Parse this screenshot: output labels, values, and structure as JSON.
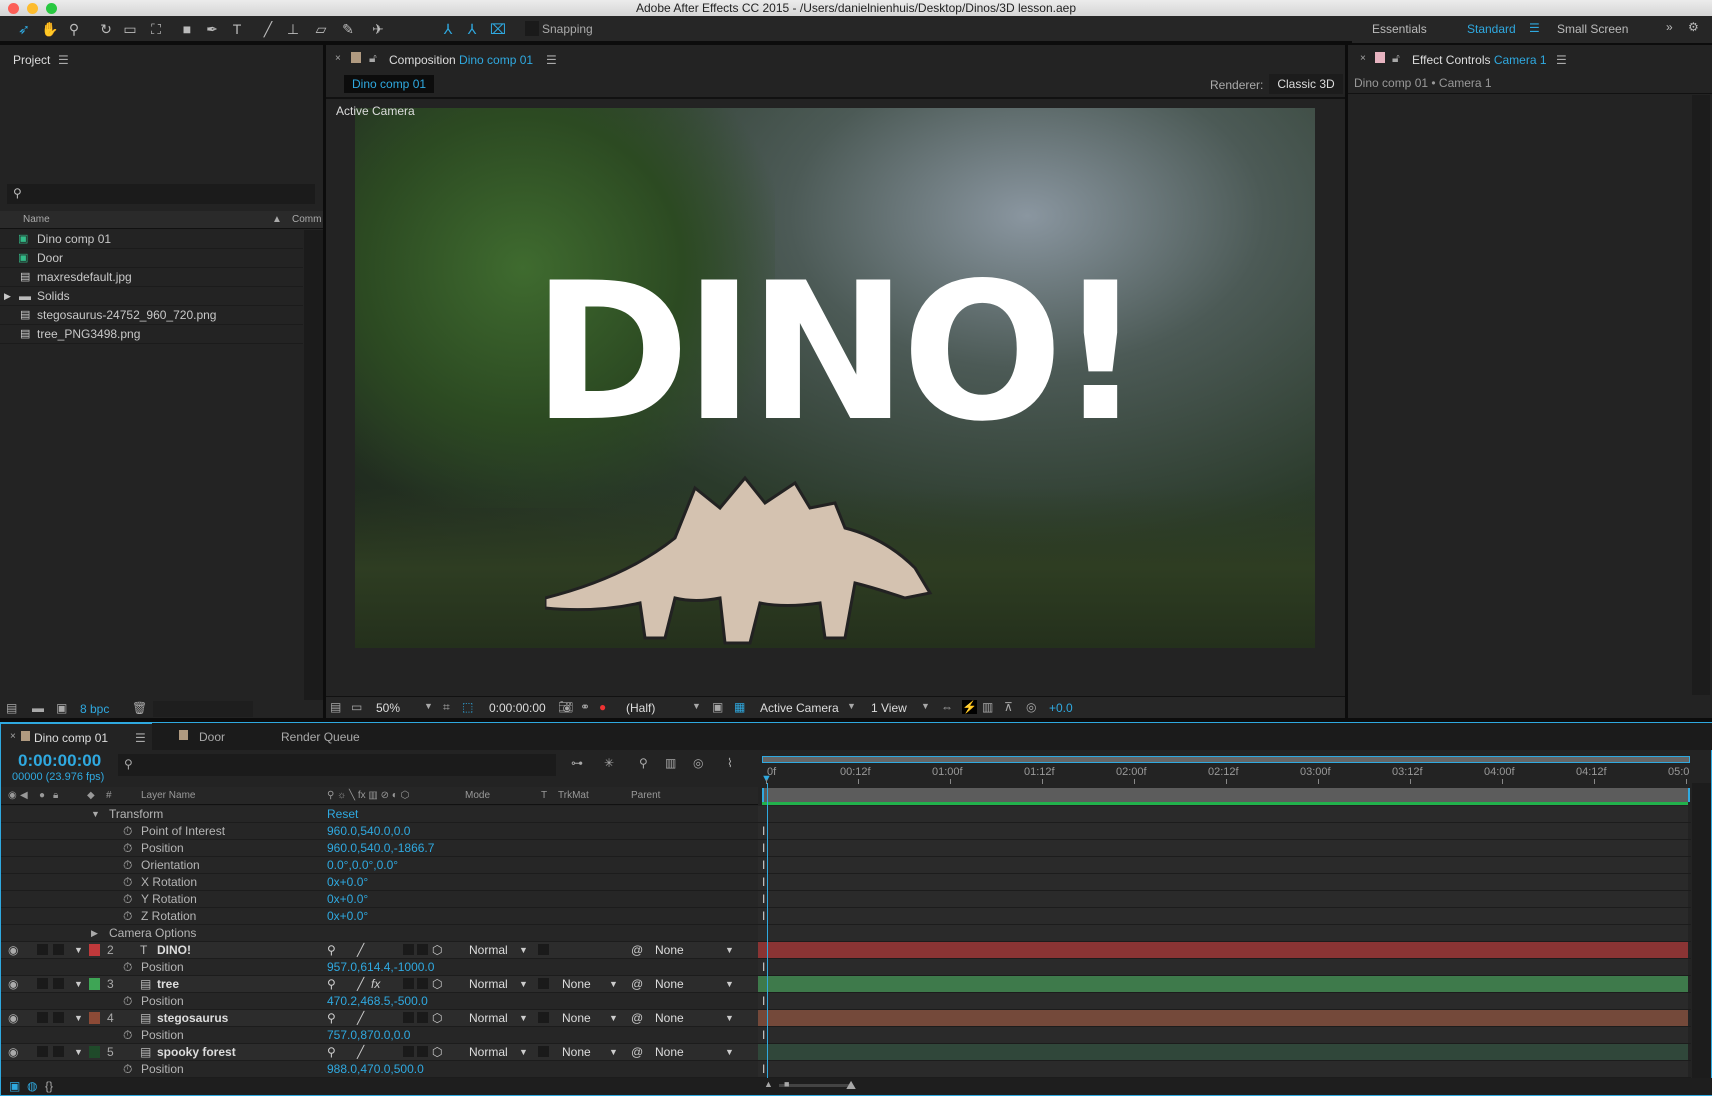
{
  "window": {
    "title": "Adobe After Effects CC 2015 - /Users/danielnienhuis/Desktop/Dinos/3D lesson.aep"
  },
  "toolbar": {
    "snapping_label": "Snapping",
    "tools": [
      "selection-icon",
      "hand-icon",
      "zoom-icon",
      "rotate-icon",
      "camera-icon",
      "pan-behind-icon",
      "rectangle-icon",
      "pen-icon",
      "text-icon",
      "brush-icon",
      "clone-stamp-icon",
      "eraser-icon",
      "roto-brush-icon",
      "puppet-pin-icon",
      "local-axis-icon",
      "world-axis-icon",
      "view-axis-icon"
    ]
  },
  "workspaces": {
    "items": [
      "Essentials",
      "Standard",
      "Small Screen"
    ],
    "active": "Standard"
  },
  "project": {
    "title": "Project",
    "search_placeholder": "",
    "col_name": "Name",
    "col_comment": "Comm",
    "items": [
      {
        "name": "Dino comp 01",
        "type": "comp"
      },
      {
        "name": "Door",
        "type": "comp"
      },
      {
        "name": "maxresdefault.jpg",
        "type": "file"
      },
      {
        "name": "Solids",
        "type": "folder"
      },
      {
        "name": "stegosaurus-24752_960_720.png",
        "type": "file"
      },
      {
        "name": "tree_PNG3498.png",
        "type": "file"
      }
    ],
    "bpc": "8 bpc"
  },
  "composition": {
    "label": "Composition",
    "name": "Dino comp 01",
    "tab": "Dino comp 01",
    "renderer_label": "Renderer:",
    "renderer": "Classic 3D",
    "view_label": "Active Camera",
    "overlay_text": "DINO!",
    "footer": {
      "zoom": "50%",
      "timecode": "0:00:00:00",
      "resolution": "(Half)",
      "camera": "Active Camera",
      "views": "1 View",
      "exposure": "+0.0"
    }
  },
  "effect_controls": {
    "label": "Effect Controls",
    "target": "Camera 1",
    "breadcrumb": "Dino comp 01 • Camera 1"
  },
  "timeline": {
    "tabs": [
      "Dino comp 01",
      "Door",
      "Render Queue"
    ],
    "timecode": "0:00:00:00",
    "frames": "00000 (23.976 fps)",
    "columns": {
      "num": "#",
      "layer_name": "Layer Name",
      "mode": "Mode",
      "t": "T",
      "trkmat": "TrkMat",
      "parent": "Parent"
    },
    "ruler": [
      "0f",
      "00:12f",
      "01:00f",
      "01:12f",
      "02:00f",
      "02:12f",
      "03:00f",
      "03:12f",
      "04:00f",
      "04:12f",
      "05:0"
    ],
    "rows": [
      {
        "kind": "group",
        "name": "Transform",
        "value": "Reset",
        "open": true
      },
      {
        "kind": "prop",
        "name": "Point of Interest",
        "value": "960.0,540.0,0.0"
      },
      {
        "kind": "prop",
        "name": "Position",
        "value": "960.0,540.0,-1866.7"
      },
      {
        "kind": "prop",
        "name": "Orientation",
        "value": "0.0°,0.0°,0.0°"
      },
      {
        "kind": "prop",
        "name": "X Rotation",
        "value": "0x+0.0°"
      },
      {
        "kind": "prop",
        "name": "Y Rotation",
        "value": "0x+0.0°"
      },
      {
        "kind": "prop",
        "name": "Z Rotation",
        "value": "0x+0.0°"
      },
      {
        "kind": "group",
        "name": "Camera Options",
        "value": "",
        "open": false
      },
      {
        "kind": "layer",
        "num": "2",
        "name": "DINO!",
        "type": "text",
        "label_color": "#c0393b",
        "bar_color": "#8a3434",
        "mode": "Normal",
        "trkmat": "",
        "parent": "None",
        "fx": false
      },
      {
        "kind": "prop",
        "name": "Position",
        "value": "957.0,614.4,-1000.0"
      },
      {
        "kind": "layer",
        "num": "3",
        "name": "tree",
        "type": "file",
        "label_color": "#3ea555",
        "bar_color": "#3e7a4b",
        "mode": "Normal",
        "trkmat": "None",
        "parent": "None",
        "fx": true
      },
      {
        "kind": "prop",
        "name": "Position",
        "value": "470.2,468.5,-500.0"
      },
      {
        "kind": "layer",
        "num": "4",
        "name": "stegosaurus",
        "type": "file",
        "label_color": "#8c4a36",
        "bar_color": "#74493a",
        "mode": "Normal",
        "trkmat": "None",
        "parent": "None",
        "fx": false
      },
      {
        "kind": "prop",
        "name": "Position",
        "value": "757.0,870.0,0.0"
      },
      {
        "kind": "layer",
        "num": "5",
        "name": "spooky forest",
        "type": "file",
        "label_color": "#1f4a2a",
        "bar_color": "#30473a",
        "mode": "Normal",
        "trkmat": "None",
        "parent": "None",
        "fx": false
      },
      {
        "kind": "prop",
        "name": "Position",
        "value": "988.0,470.0,500.0"
      }
    ]
  },
  "colors": {
    "accent": "#2fa9e0",
    "work_area": "#22b14c"
  }
}
